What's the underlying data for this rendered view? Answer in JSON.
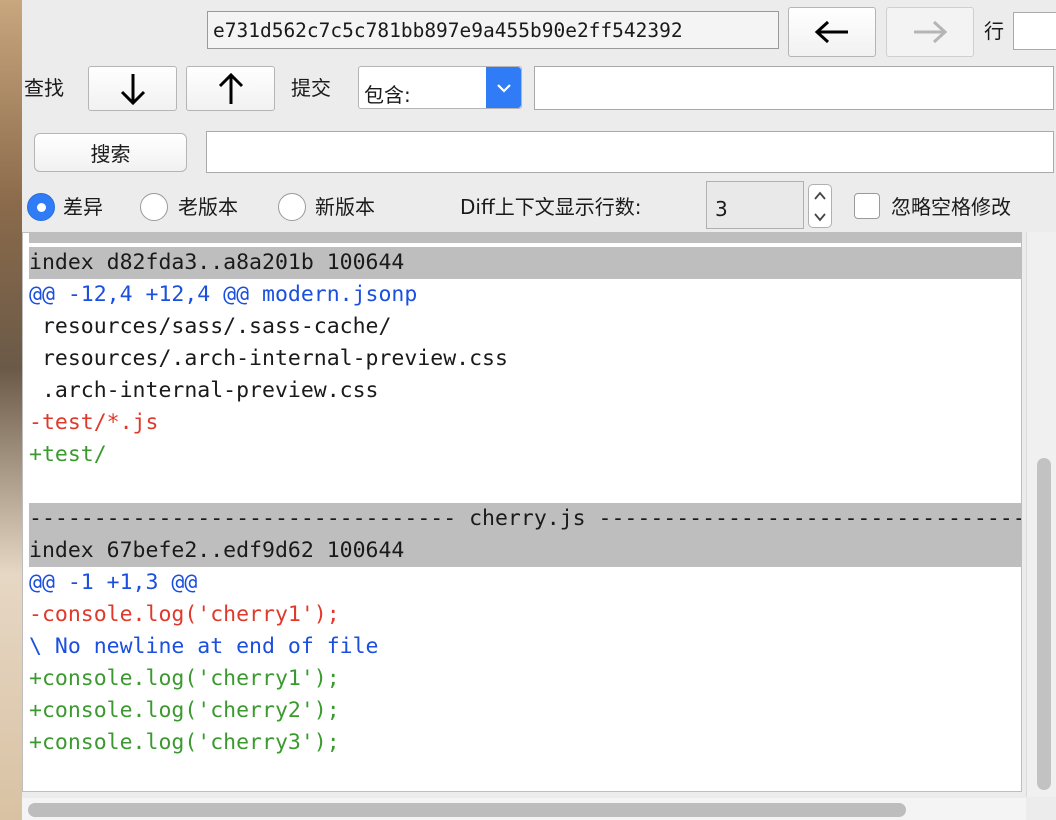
{
  "toolbar": {
    "sha_value": "e731d562c7c5c781bb897e9a455b90e2ff542392",
    "back_icon": "arrow-left-icon",
    "forward_icon": "arrow-right-icon",
    "row_label": "行"
  },
  "find": {
    "label": "查找",
    "down_icon": "arrow-down-icon",
    "up_icon": "arrow-up-icon",
    "commit_label": "提交",
    "select_value": "包含:",
    "input_value": ""
  },
  "search": {
    "button_label": "搜索",
    "input_value": ""
  },
  "options": {
    "radio_diff": "差异",
    "radio_old": "老版本",
    "radio_new": "新版本",
    "context_label": "Diff上下文显示行数:",
    "context_value": "3",
    "ignore_ws_label": "忽略空格修改"
  },
  "diff": {
    "lines": [
      {
        "text": "index d82fda3..a8a201b 100644",
        "kind": "header"
      },
      {
        "text": "@@ -12,4 +12,4 @@ modern.jsonp",
        "kind": "hunk"
      },
      {
        "text": " resources/sass/.sass-cache/",
        "kind": "context"
      },
      {
        "text": " resources/.arch-internal-preview.css",
        "kind": "context"
      },
      {
        "text": " .arch-internal-preview.css",
        "kind": "context"
      },
      {
        "text": "-test/*.js",
        "kind": "removed"
      },
      {
        "text": "+test/",
        "kind": "added"
      },
      {
        "text": "",
        "kind": "blank"
      },
      {
        "text": "--------------------------------- cherry.js ---------------------------------",
        "kind": "header"
      },
      {
        "text": "index 67befe2..edf9d62 100644",
        "kind": "header"
      },
      {
        "text": "@@ -1 +1,3 @@",
        "kind": "hunk"
      },
      {
        "text": "-console.log('cherry1');",
        "kind": "removed"
      },
      {
        "text": "\\ No newline at end of file",
        "kind": "hunk"
      },
      {
        "text": "+console.log('cherry1');",
        "kind": "added"
      },
      {
        "text": "+console.log('cherry2');",
        "kind": "added"
      },
      {
        "text": "+console.log('cherry3');",
        "kind": "added"
      }
    ]
  },
  "colors": {
    "removed": "#e0392b",
    "added": "#3a9a2e",
    "hunk": "#1a4fe0",
    "header_bg": "#bebebe",
    "accent": "#2f7cf6"
  }
}
